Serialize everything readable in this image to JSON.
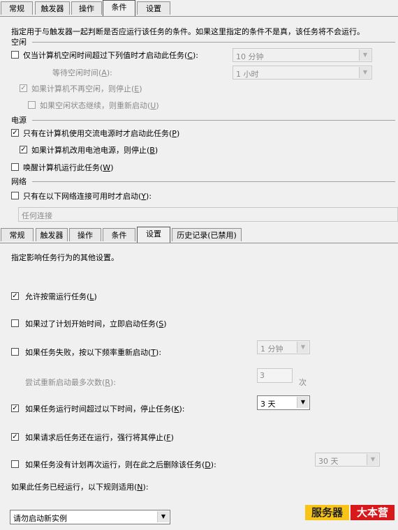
{
  "top": {
    "tabs": [
      "常规",
      "触发器",
      "操作",
      "条件",
      "设置"
    ],
    "description": "指定用于与触发器一起判断是否应运行该任务的条件。如果这里指定的条件不是真，该任务将不会运行。",
    "idle_section": "空闲",
    "idle_start_label": "仅当计算机空闲时间超过下列值时才启动此任务(",
    "idle_start_key": "C",
    "idle_duration": "10 分钟",
    "idle_wait_label": "等待空闲时间(",
    "idle_wait_key": "A",
    "idle_wait": "1 小时",
    "idle_stop_label": "如果计算机不再空闲，则停止(",
    "idle_stop_key": "E",
    "idle_restart_label": "如果空闲状态继续，则重新启动(",
    "idle_restart_key": "U",
    "power_section": "电源",
    "ac_label": "只有在计算机使用交流电源时才启动此任务(",
    "ac_key": "P",
    "battery_label": "如果计算机改用电池电源，则停止(",
    "battery_key": "B",
    "wake_label": "唤醒计算机运行此任务(",
    "wake_key": "W",
    "network_section": "网络",
    "network_label": "只有在以下网络连接可用时才启动(",
    "network_key": "Y",
    "network_value": "任何连接"
  },
  "bottom": {
    "tabs": [
      "常规",
      "触发器",
      "操作",
      "条件",
      "设置",
      "历史记录(已禁用)"
    ],
    "description": "指定影响任务行为的其他设置。",
    "on_demand_label": "允许按需运行任务(",
    "on_demand_key": "L",
    "missed_label": "如果过了计划开始时间，立即启动任务(",
    "missed_key": "S",
    "restart_fail_label": "如果任务失败，按以下频率重新启动(",
    "restart_fail_key": "T",
    "restart_interval": "1 分钟",
    "restart_attempts_label": "尝试重新启动最多次数(",
    "restart_attempts_key": "R",
    "restart_attempts_value": "3",
    "restart_attempts_unit": "次",
    "stop_long_label": "如果任务运行时间超过以下时间，停止任务(",
    "stop_long_key": "K",
    "stop_long_value": "3 天",
    "force_stop_label": "如果请求后任务还在运行，强行将其停止(",
    "force_stop_key": "F",
    "delete_label": "如果任务没有计划再次运行，则在此之后删除该任务(",
    "delete_key": "D",
    "delete_value": "30 天",
    "rule_label": "如果此任务已经运行，以下规则适用(",
    "rule_key": "N",
    "rule_value": "请勿启动新实例"
  },
  "watermark": {
    "left": "服务器",
    "right": "大本营"
  },
  "colors": {
    "brand_yellow": "#f7c417",
    "brand_red": "#d9181c"
  }
}
